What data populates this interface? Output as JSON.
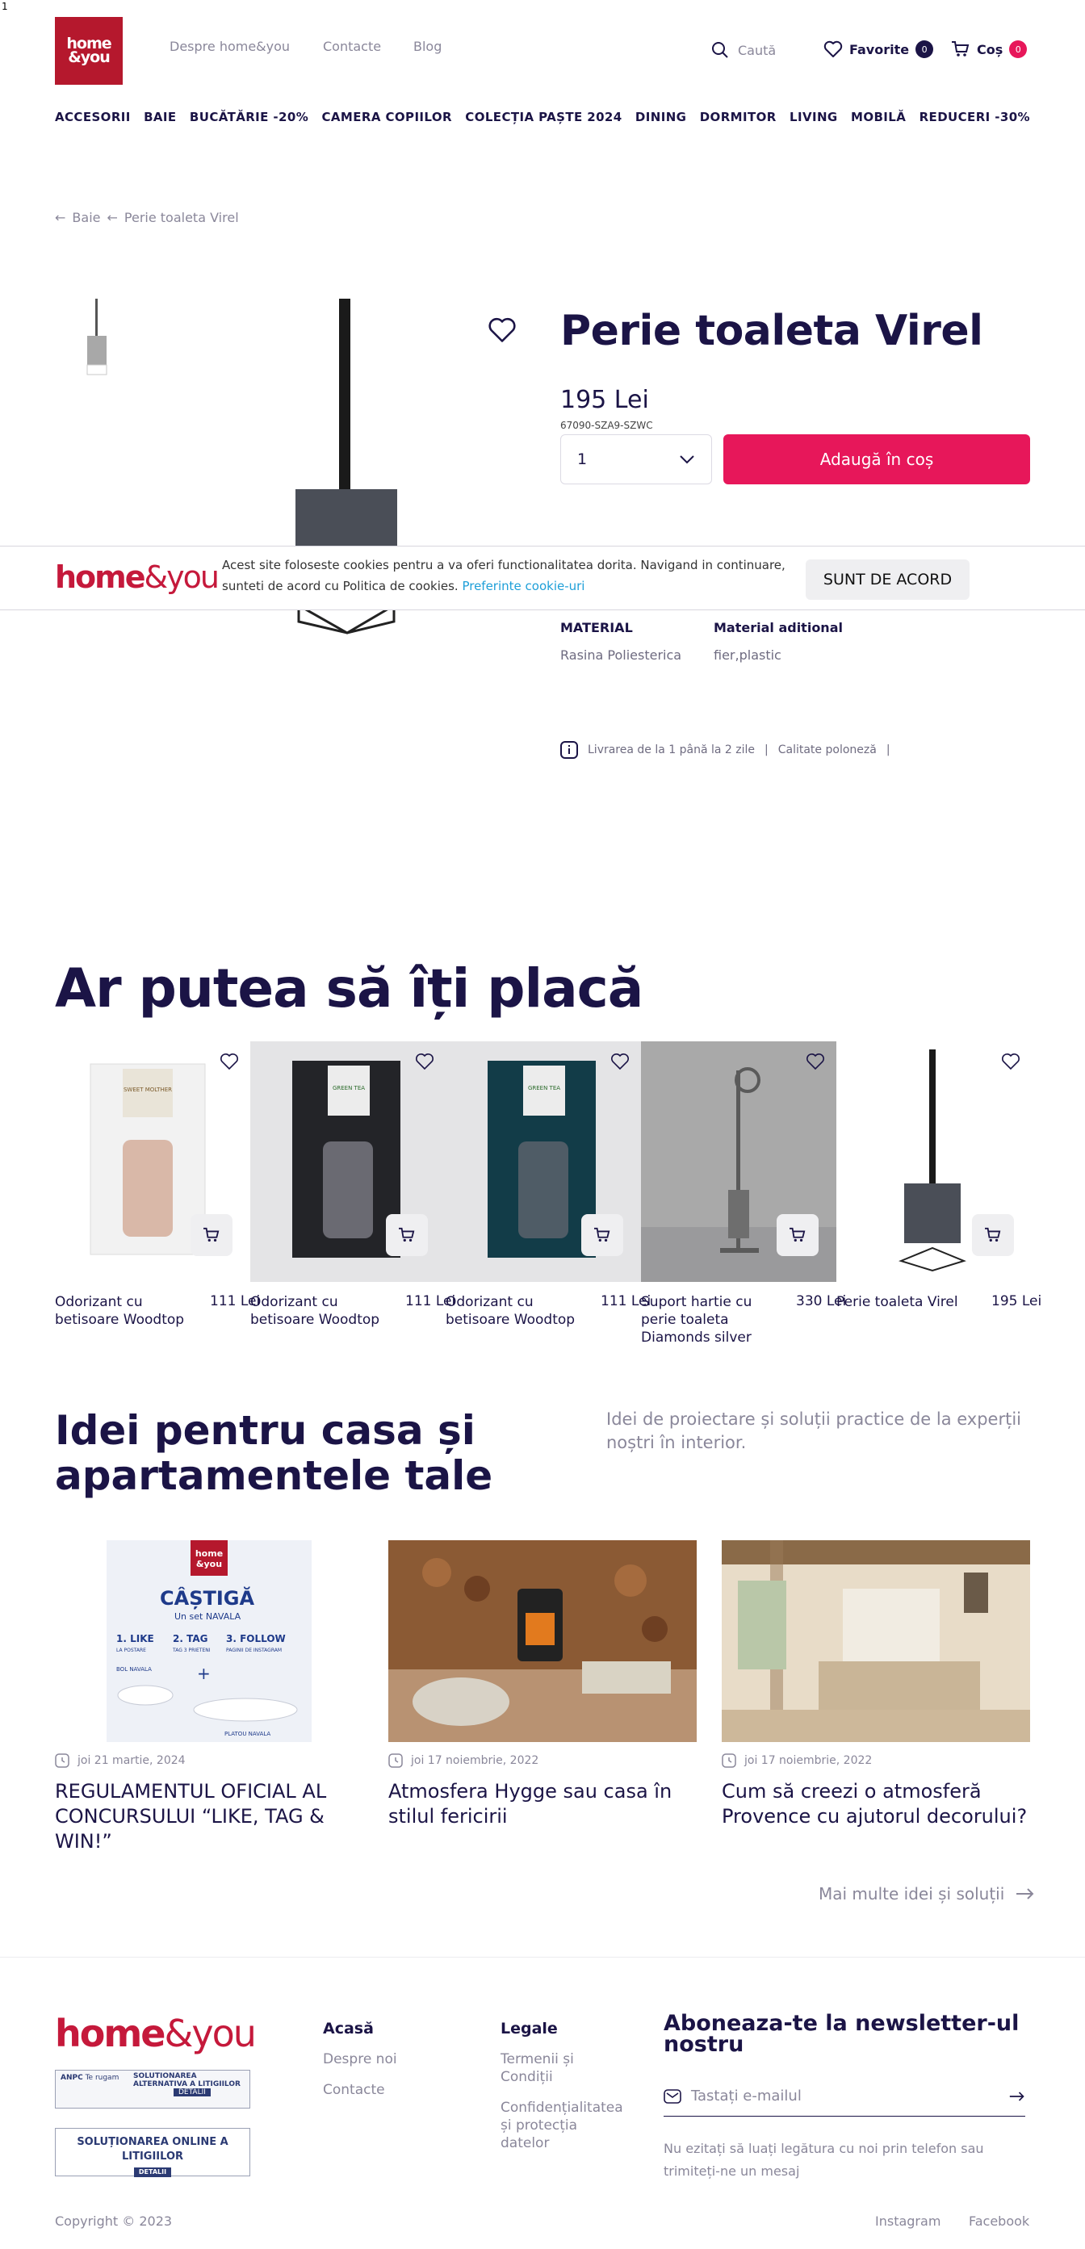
{
  "marker": "1",
  "header": {
    "logo_top": "home",
    "logo_bottom": "&you",
    "links": [
      "Despre home&you",
      "Contacte",
      "Blog"
    ],
    "search_placeholder": "Caută",
    "favorites_label": "Favorite",
    "favorites_count": "0",
    "cart_label": "Coș",
    "cart_count": "0",
    "accent_color": "#e7175a",
    "logo_color": "#b5182d"
  },
  "nav": [
    "ACCESORII",
    "BAIE",
    "BUCĂTĂRIE -20%",
    "CAMERA COPIILOR",
    "COLECȚIA PAȘTE 2024",
    "DINING",
    "DORMITOR",
    "LIVING",
    "MOBILĂ",
    "REDUCERI -30%"
  ],
  "breadcrumb": [
    "Baie",
    "Perie toaleta Virel"
  ],
  "product": {
    "title": "Perie toaleta Virel",
    "price": "195 Lei",
    "sku": "67090-SZA9-SZWC",
    "quantity": "1",
    "add_to_cart": "Adaugă în coș",
    "specs": [
      {
        "label": "MATERIAL",
        "value": "Rasina Poliesterica"
      },
      {
        "label": "Material aditional",
        "value": "fier,plastic"
      }
    ],
    "delivery": [
      "Livrarea de la 1 până la 2 zile",
      "Calitate poloneză"
    ]
  },
  "cookie": {
    "logo_a": "home",
    "logo_b": "&you",
    "text": "Acest site foloseste cookies pentru a va oferi functionalitatea dorita. Navigand in continuare, sunteti de acord cu Politica de cookies.",
    "link": "Preferinte cookie-uri",
    "accept": "SUNT DE ACORD"
  },
  "recommendations": {
    "title": "Ar putea să îți placă",
    "items": [
      {
        "name": "Odorizant cu betisoare Woodtop",
        "price": "111 Lei",
        "label": "SWEET MOLTHER"
      },
      {
        "name": "Odorizant cu betisoare Woodtop",
        "price": "111 Lei",
        "label": "GREEN TEA"
      },
      {
        "name": "Odorizant cu betisoare Woodtop",
        "price": "111 Lei",
        "label": "GREEN TEA"
      },
      {
        "name": "Suport hartie cu perie toaleta Diamonds silver",
        "price": "330 Lei",
        "label": ""
      },
      {
        "name": "Perie toaleta Virel",
        "price": "195 Lei",
        "label": ""
      }
    ]
  },
  "ideas": {
    "title": "Idei pentru casa și apartamentele tale",
    "subtitle": "Idei de proiectare și soluții practice de la experții noștri în interior.",
    "posts": [
      {
        "date": "joi 21 martie, 2024",
        "title": "REGULAMENTUL OFICIAL AL CONCURSULUI “LIKE, TAG & WIN!”"
      },
      {
        "date": "joi 17 noiembrie, 2022",
        "title": "Atmosfera Hygge sau casa în stilul fericirii"
      },
      {
        "date": "joi 17 noiembrie, 2022",
        "title": "Cum să creezi o atmosferă Provence cu ajutorul decorului?"
      }
    ],
    "promo": {
      "logo_top": "home",
      "logo_bottom": "&you",
      "headline": "CÂȘTIGĂ",
      "sub": "Un set NAVALA",
      "steps": [
        "1. LIKE",
        "2. TAG",
        "3. FOLLOW"
      ],
      "step_notes": [
        "LA POSTARE",
        "TAG 3 PRIETENI",
        "PAGINII DE INSTAGRAM"
      ],
      "bowl": "BOL NAVALA",
      "plate": "PLATOU NAVALA"
    },
    "more": "Mai multe idei și soluții"
  },
  "footer": {
    "logo_a": "home",
    "logo_b": "&you",
    "anpc_a": "ANPC",
    "anpc_a_sub": "Te rugam",
    "anpc_a_text": "SOLUTIONAREA ALTERNATIVA A LITIGIILOR",
    "anpc_a_btn": "DETALII",
    "anpc_b_text": "SOLUȚIONAREA ONLINE A LITIGIILOR",
    "anpc_b_btn": "DETALII",
    "col1_title": "Acasă",
    "col1_links": [
      "Despre noi",
      "Contacte"
    ],
    "col2_title": "Legale",
    "col2_links": [
      "Termenii și Condiții",
      "Confidențialitatea și protecția datelor"
    ],
    "newsletter_title": "Aboneaza-te la newsletter-ul nostru",
    "email_placeholder": "Tastați e-mailul",
    "newsletter_note": "Nu ezitați să luați legătura cu noi prin telefon sau trimiteți-ne un mesaj",
    "copyright": "Copyright © 2023",
    "social": [
      "Instagram",
      "Facebook"
    ]
  }
}
